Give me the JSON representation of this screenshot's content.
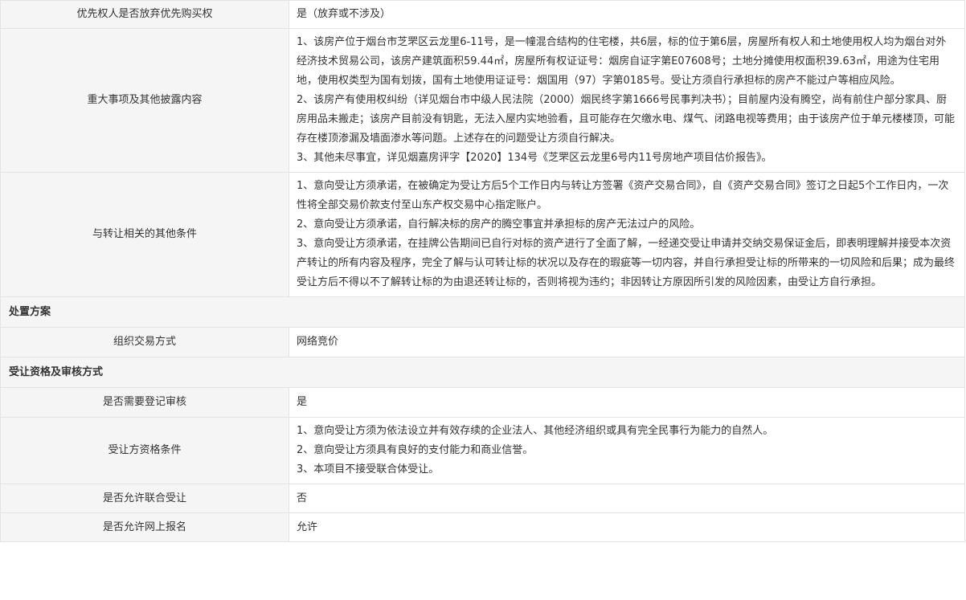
{
  "rows": {
    "preemptive": {
      "label": "优先权人是否放弃优先购买权",
      "value": "是（放弃或不涉及）"
    },
    "major_matters": {
      "label": "重大事项及其他披露内容",
      "items": [
        "1、该房产位于烟台市芝罘区云龙里6-11号，是一幢混合结构的住宅楼，共6层，标的位于第6层，房屋所有权人和土地使用权人均为烟台对外经济技术贸易公司，该房产建筑面积59.44㎡，房屋所有权证证号：烟房自证字第E07608号；土地分摊使用权面积39.63㎡，用途为住宅用地，使用权类型为国有划拨，国有土地使用证证号：烟国用（97）字第0185号。受让方须自行承担标的房产不能过户等相应风险。",
        "2、该房产有使用权纠纷（详见烟台市中级人民法院（2000）烟民终字第1666号民事判决书）；目前屋内没有腾空，尚有前住户部分家具、厨房用品未搬走；该房产目前没有钥匙，无法入屋内实地验看，且可能存在欠缴水电、煤气、闭路电视等费用；由于该房产位于单元楼楼顶，可能存在楼顶渗漏及墙面渗水等问题。上述存在的问题受让方须自行解决。",
        "3、其他未尽事宜，详见烟嘉房评字【2020】134号《芝罘区云龙里6号内11号房地产项目估价报告》。"
      ]
    },
    "transfer_conditions": {
      "label": "与转让相关的其他条件",
      "items": [
        "1、意向受让方须承诺，在被确定为受让方后5个工作日内与转让方签署《资产交易合同》，自《资产交易合同》签订之日起5个工作日内，一次性将全部交易价款支付至山东产权交易中心指定账户。",
        "2、意向受让方须承诺，自行解决标的房产的腾空事宜并承担标的房产无法过户的风险。",
        "3、意向受让方须承诺，在挂牌公告期间已自行对标的资产进行了全面了解，一经递交受让申请并交纳交易保证金后，即表明理解并接受本次资产转让的所有内容及程序，完全了解与认可转让标的状况以及存在的瑕疵等一切内容，并自行承担受让标的所带来的一切风险和后果；成为最终受让方后不得以不了解转让标的为由退还转让标的，否则将视为违约；非因转让方原因所引发的风险因素，由受让方自行承担。"
      ]
    },
    "disposal_section": "处置方案",
    "trade_method": {
      "label": "组织交易方式",
      "value": "网络竞价"
    },
    "qualification_section": "受让资格及审核方式",
    "registration_review": {
      "label": "是否需要登记审核",
      "value": "是"
    },
    "transferee_qualification": {
      "label": "受让方资格条件",
      "items": [
        "1、意向受让方须为依法设立并有效存续的企业法人、其他经济组织或具有完全民事行为能力的自然人。",
        "2、意向受让方须具有良好的支付能力和商业信誉。",
        "3、本项目不接受联合体受让。"
      ]
    },
    "joint_bidding": {
      "label": "是否允许联合受让",
      "value": "否"
    },
    "online_registration": {
      "label": "是否允许网上报名",
      "value": "允许"
    }
  }
}
